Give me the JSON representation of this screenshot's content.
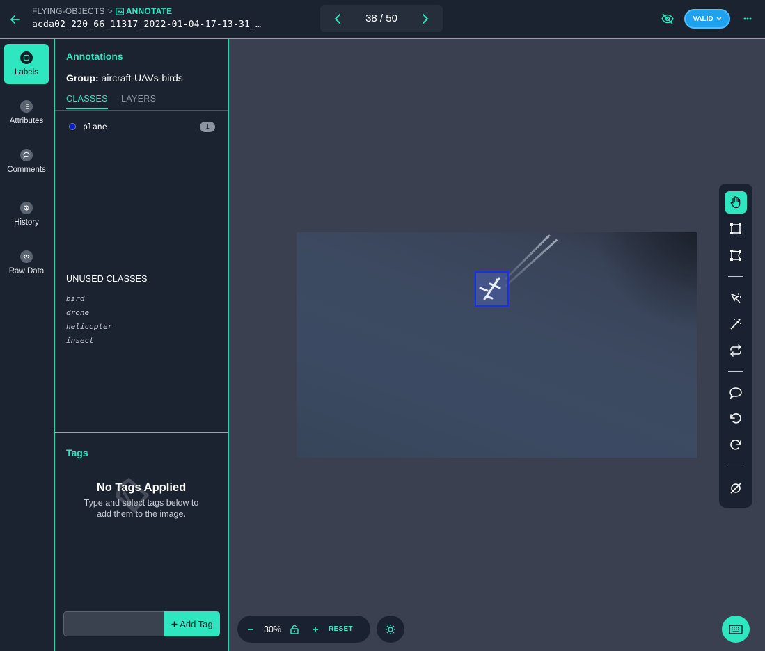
{
  "header": {
    "breadcrumb_project": "FLYING-OBJECTS",
    "breadcrumb_separator": ">",
    "breadcrumb_mode": "ANNOTATE",
    "filename": "acda02_220_66_11317_2022-01-04-17-13-31_…",
    "pager_count": "38 / 50",
    "status_label": "VALID"
  },
  "nav": {
    "items": [
      {
        "label": "Labels",
        "icon": "label-icon",
        "active": true
      },
      {
        "label": "Attributes",
        "icon": "list-icon",
        "active": false
      },
      {
        "label": "Comments",
        "icon": "comment-icon",
        "active": false
      },
      {
        "label": "History",
        "icon": "history-icon",
        "active": false
      },
      {
        "label": "Raw Data",
        "icon": "code-icon",
        "active": false
      }
    ]
  },
  "annotations": {
    "title": "Annotations",
    "group_label": "Group:",
    "group_name": "aircraft-UAVs-birds",
    "tabs": [
      "CLASSES",
      "LAYERS"
    ],
    "classes": [
      {
        "name": "plane",
        "count": "1",
        "color": "#0a1ccc"
      }
    ],
    "unused_title": "UNUSED CLASSES",
    "unused": [
      "bird",
      "drone",
      "helicopter",
      "insect"
    ]
  },
  "tags": {
    "title": "Tags",
    "empty_title": "No Tags Applied",
    "empty_line1": "Type and select tags below to",
    "empty_line2": "add them to the image.",
    "input_value": "",
    "add_label": "Add Tag"
  },
  "toolbar": {
    "tools": [
      "hand-icon",
      "bounding-box-icon",
      "polygon-icon",
      "smart-select-icon",
      "magic-wand-icon",
      "repeat-icon",
      "comment-icon",
      "undo-icon",
      "redo-icon",
      "hide-icon"
    ]
  },
  "zoom": {
    "level": "30%",
    "reset_label": "RESET"
  },
  "colors": {
    "accent": "#2ee6bf",
    "status": "#1ea1ef",
    "bbox": "#1530f0"
  }
}
